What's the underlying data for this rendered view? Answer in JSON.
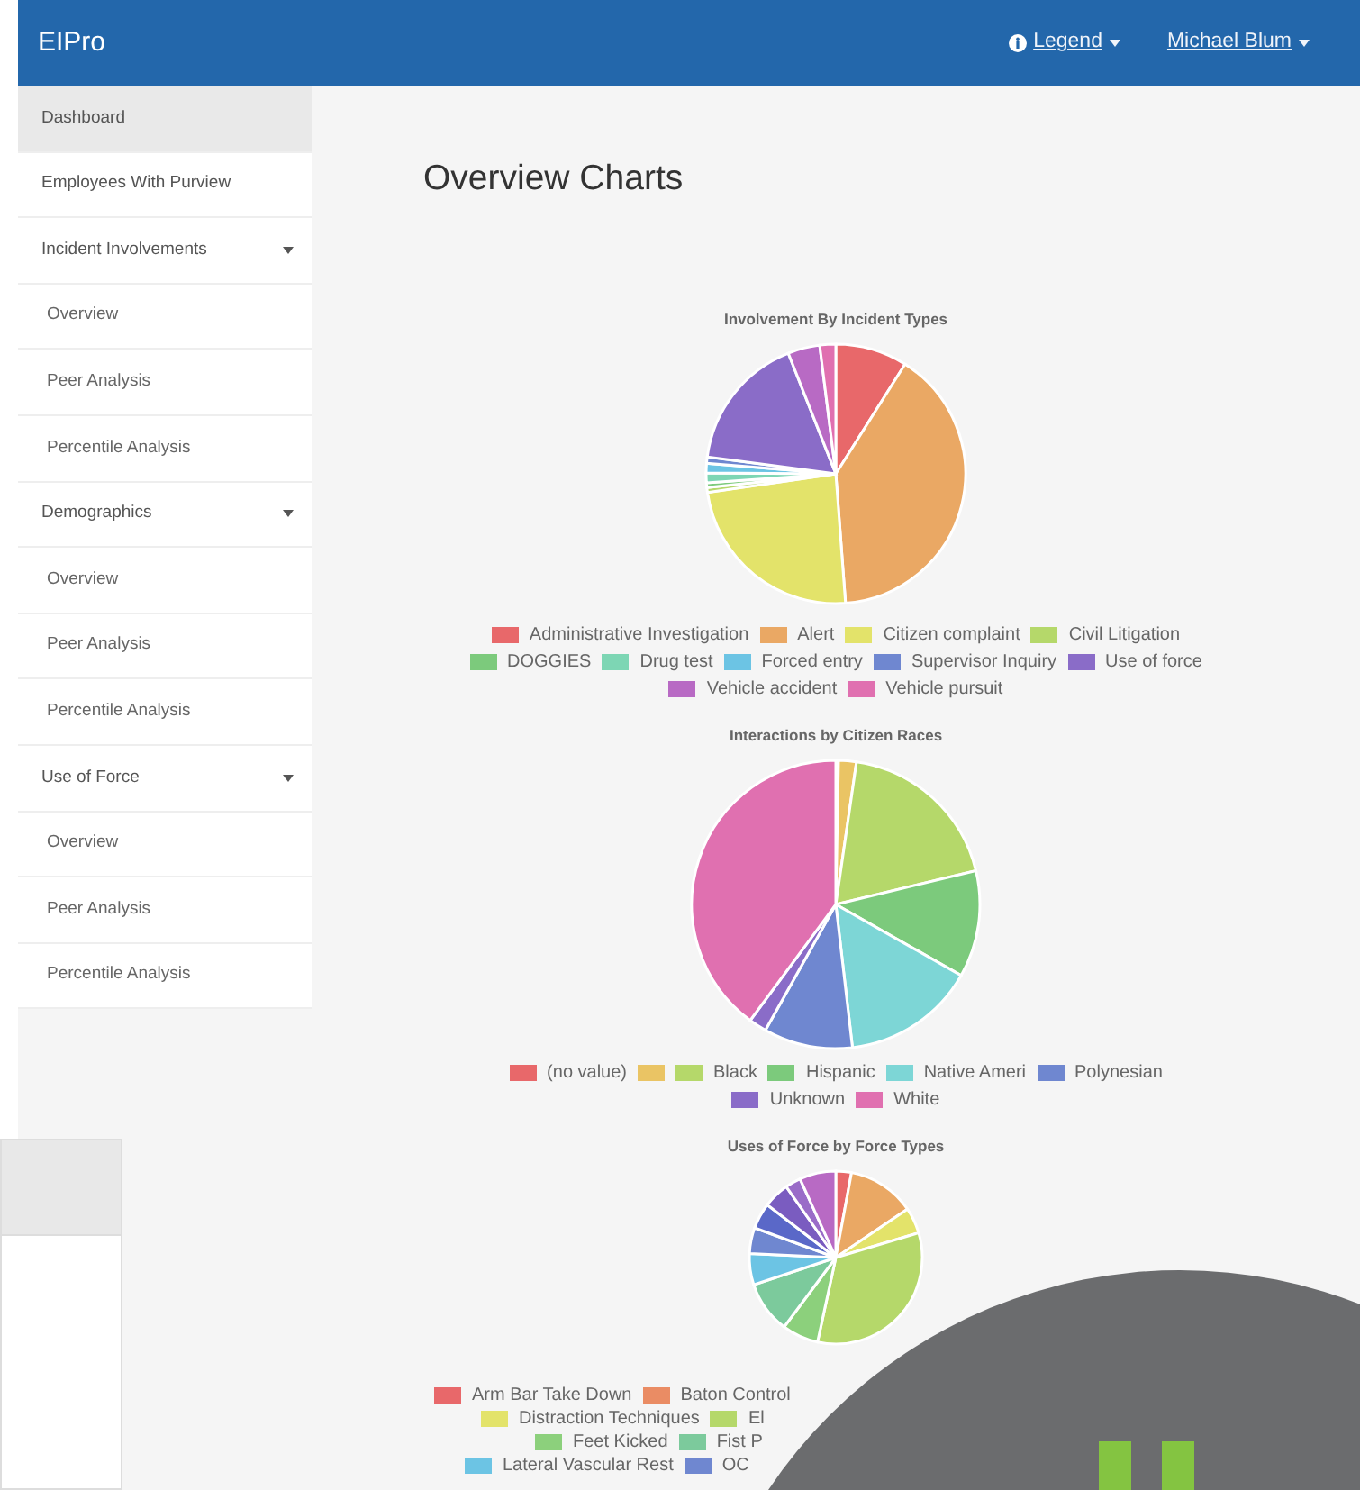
{
  "navbar": {
    "brand": "EIPro",
    "menus": [
      {
        "label": "Legend"
      },
      {
        "label": "Michael Blum"
      }
    ]
  },
  "sidebar": {
    "items": [
      {
        "label": "Dashboard",
        "selected": true
      },
      {
        "label": "Employees With Purview",
        "selected": false
      },
      {
        "label": "Incident Involvements",
        "selected": false,
        "children": [
          {
            "label": "Overview",
            "selected": false
          },
          {
            "label": "Peer Analysis",
            "selected": false
          },
          {
            "label": "Percentile Analysis",
            "selected": false
          }
        ]
      },
      {
        "label": "Demographics",
        "selected": false,
        "children": [
          {
            "label": "Overview",
            "selected": false
          },
          {
            "label": "Peer Analysis",
            "selected": false
          },
          {
            "label": "Percentile Analysis",
            "selected": false
          }
        ]
      },
      {
        "label": "Use of Force",
        "selected": false,
        "children": [
          {
            "label": "Overview",
            "selected": false
          },
          {
            "label": "Peer Analysis",
            "selected": false
          },
          {
            "label": "Percentile Analysis",
            "selected": false
          }
        ]
      }
    ]
  },
  "page_title": "Overview Charts",
  "charts": [
    {
      "title": "Involvement By Incident Types",
      "legend_rows": [
        [
          {
            "label": "Administrative Investigation",
            "color": "#e8686a"
          },
          {
            "label": "Alert",
            "color": "#eaa864"
          },
          {
            "label": "Citizen complaint",
            "color": "#e3e36a"
          },
          {
            "label": "Civil Litigation",
            "color": "#b5d86a"
          }
        ],
        [
          {
            "label": "DOGGIES",
            "color": "#7cca7c"
          },
          {
            "label": "Drug test",
            "color": "#7dd6b4"
          },
          {
            "label": "Forced entry",
            "color": "#6cc4e4"
          },
          {
            "label": "Supervisor Inquiry",
            "color": "#6f87d0"
          },
          {
            "label": "Use of force",
            "color": "#8a6cc8"
          }
        ],
        [
          {
            "label": "Vehicle accident",
            "color": "#b86ac4"
          },
          {
            "label": "Vehicle pursuit",
            "color": "#e070b0"
          }
        ]
      ]
    },
    {
      "title": "Interactions by Citizen Races",
      "legend_rows": [
        [
          {
            "label": "(no value)",
            "color": "#e8686a"
          },
          {
            "color": "#eac464"
          },
          {
            "label": "Black",
            "color": "#b5d86a"
          },
          {
            "label": "Hispanic",
            "color": "#7cca7c"
          },
          {
            "label": "Native Ameri",
            "color": "#7dd6d6"
          },
          {
            "label": "Polynesian",
            "color": "#6f87d0"
          }
        ],
        [
          {
            "label": "Unknown",
            "color": "#8a6cc8"
          },
          {
            "label": "White",
            "color": "#e070b0"
          }
        ]
      ]
    },
    {
      "title": "Uses of Force by Force Types",
      "legend_rows": [
        [
          {
            "label": "Arm Bar Take Down",
            "color": "#e8686a"
          },
          {
            "label": "Baton Control",
            "color": "#ea8c64"
          }
        ],
        [
          {
            "label": "Distraction Techniques",
            "color": "#e3e36a"
          },
          {
            "label": "El",
            "color": "#b5d86a"
          }
        ],
        [
          {
            "label": "Feet Kicked",
            "color": "#8cd07c"
          },
          {
            "label": "Fist P",
            "color": "#7cca9c"
          }
        ],
        [
          {
            "label": "Lateral Vascular Rest",
            "color": "#6cc4e4"
          },
          {
            "label": "OC",
            "color": "#6f87d0"
          }
        ]
      ]
    }
  ]
}
